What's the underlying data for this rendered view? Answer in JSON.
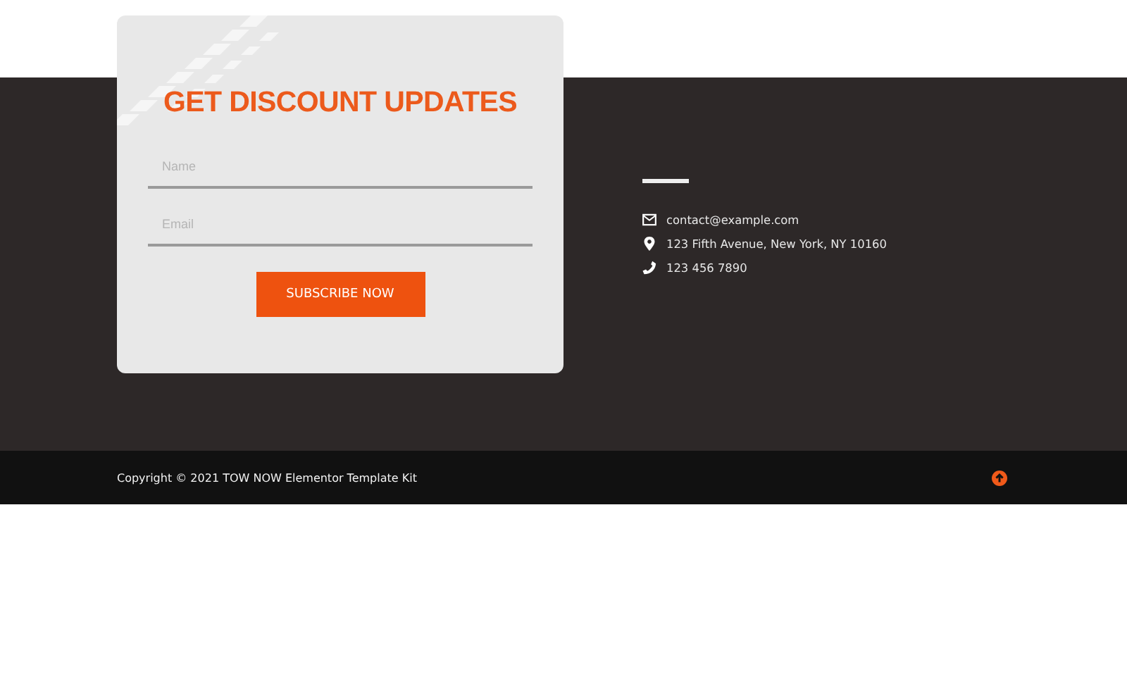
{
  "newsletter": {
    "title": "GET DISCOUNT UPDATES",
    "fields": [
      {
        "placeholder": "Name"
      },
      {
        "placeholder": "Email"
      }
    ],
    "button": "SUBSCRIBE NOW"
  },
  "contact": [
    {
      "kind": "email",
      "text": "contact@example.com"
    },
    {
      "kind": "location",
      "text": "123 Fifth Avenue, New York, NY 10160"
    },
    {
      "kind": "phone",
      "text": "123 456 7890"
    }
  ],
  "footer": {
    "copyright": "Copyright © 2021 TOW NOW Elementor Template Kit"
  }
}
